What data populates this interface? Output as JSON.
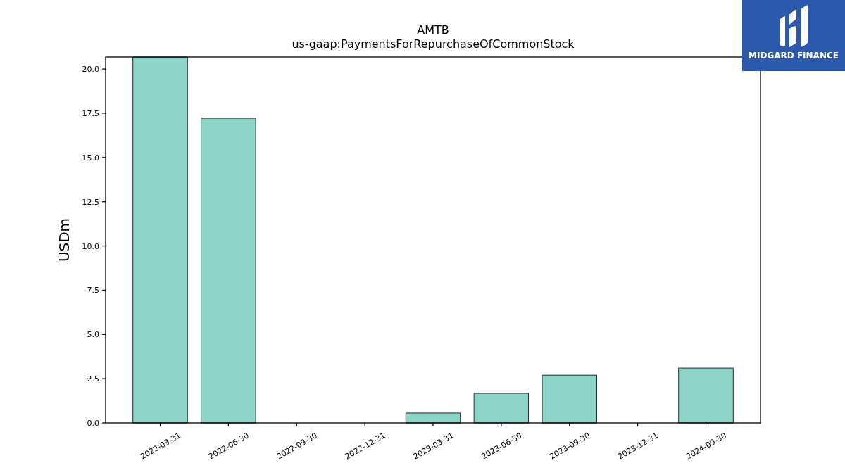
{
  "chart": {
    "title": "AMTB",
    "subtitle": "us-gaap:PaymentsForRepurchaseOfCommonStock",
    "chart_data": {
      "type": "bar",
      "ylabel": "USDm",
      "categories": [
        "2022-03-31",
        "2022-06-30",
        "2022-09-30",
        "2022-12-31",
        "2023-03-31",
        "2023-06-30",
        "2023-09-30",
        "2023-12-31",
        "2024-09-30"
      ],
      "series": [
        {
          "color": "#8dd3c7",
          "values": [
            20.68,
            17.22,
            0,
            0,
            0.56,
            1.67,
            2.7,
            0,
            3.1
          ]
        }
      ],
      "ylim": [
        0,
        20.68
      ],
      "yticks": [
        {
          "value": 0,
          "label": "0.0"
        },
        {
          "value": 2.5,
          "label": "2.5"
        },
        {
          "value": 5,
          "label": "5.0"
        },
        {
          "value": 7.5,
          "label": "7.5"
        },
        {
          "value": 10,
          "label": "10.0"
        },
        {
          "value": 12.5,
          "label": "12.5"
        },
        {
          "value": 15,
          "label": "15.0"
        },
        {
          "value": 17.5,
          "label": "17.5"
        },
        {
          "value": 20,
          "label": "20.0"
        }
      ]
    }
  },
  "logo": {
    "text": "MIDGARD FINANCE"
  }
}
